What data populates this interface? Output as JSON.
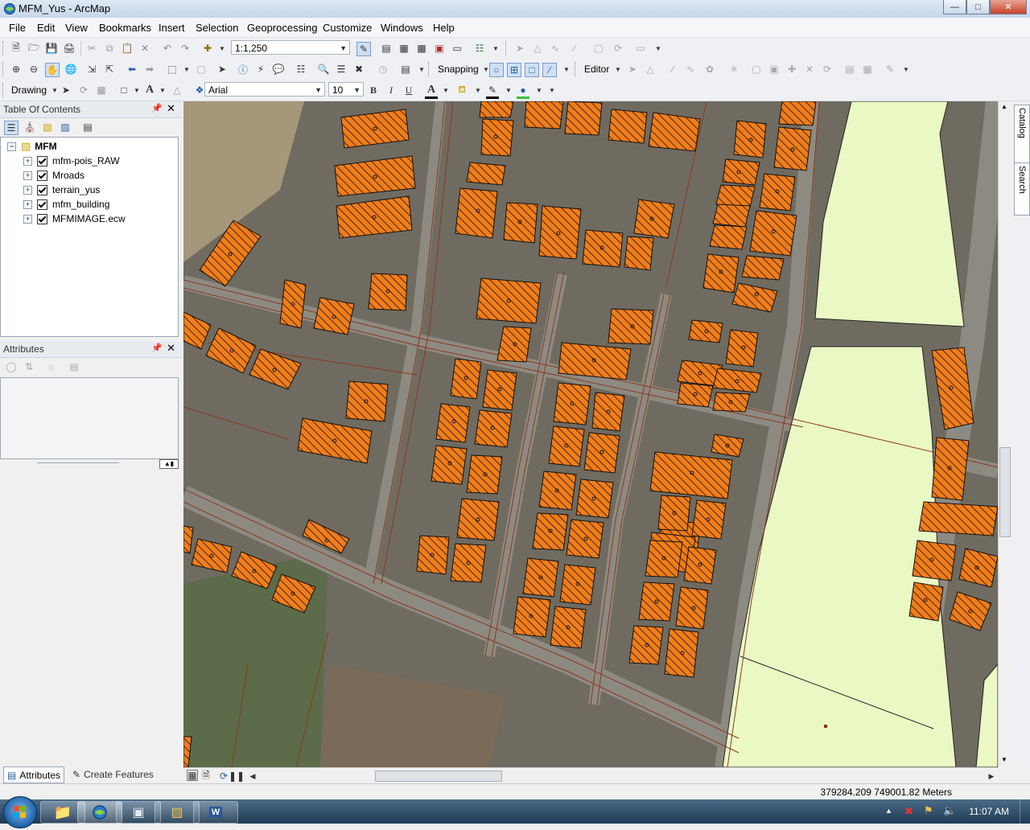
{
  "window": {
    "title": "MFM_Yus - ArcMap"
  },
  "menu": [
    "File",
    "Edit",
    "View",
    "Bookmarks",
    "Insert",
    "Selection",
    "Geoprocessing",
    "Customize",
    "Windows",
    "Help"
  ],
  "toolbar": {
    "scale": "1:1,250",
    "snapping_label": "Snapping",
    "editor_label": "Editor",
    "drawing_label": "Drawing",
    "font_name": "Arial",
    "font_size": "10",
    "bold": "B",
    "italic": "I",
    "underline": "U",
    "font_color_glyph": "A"
  },
  "toc": {
    "title": "Table Of Contents",
    "dataframe": "MFM",
    "layers": [
      {
        "name": "mfm-pois_RAW",
        "checked": true
      },
      {
        "name": "Mroads",
        "checked": true
      },
      {
        "name": "terrain_yus",
        "checked": true
      },
      {
        "name": "mfm_building",
        "checked": true
      },
      {
        "name": "MFMIMAGE.ecw",
        "checked": true
      }
    ]
  },
  "attributes_panel": {
    "title": "Attributes"
  },
  "bottom_tabs": {
    "attributes": "Attributes",
    "create_features": "Create Features"
  },
  "right_dock": {
    "catalog": "Catalog",
    "search": "Search"
  },
  "status": {
    "coordinates": "379284.209  749001.82 Meters"
  },
  "taskbar": {
    "clock": "11:07 AM"
  },
  "colors": {
    "building_fill": "#f07d1a",
    "terrain_fill": "#eaf9c4",
    "road_line": "#8a3a1c"
  }
}
